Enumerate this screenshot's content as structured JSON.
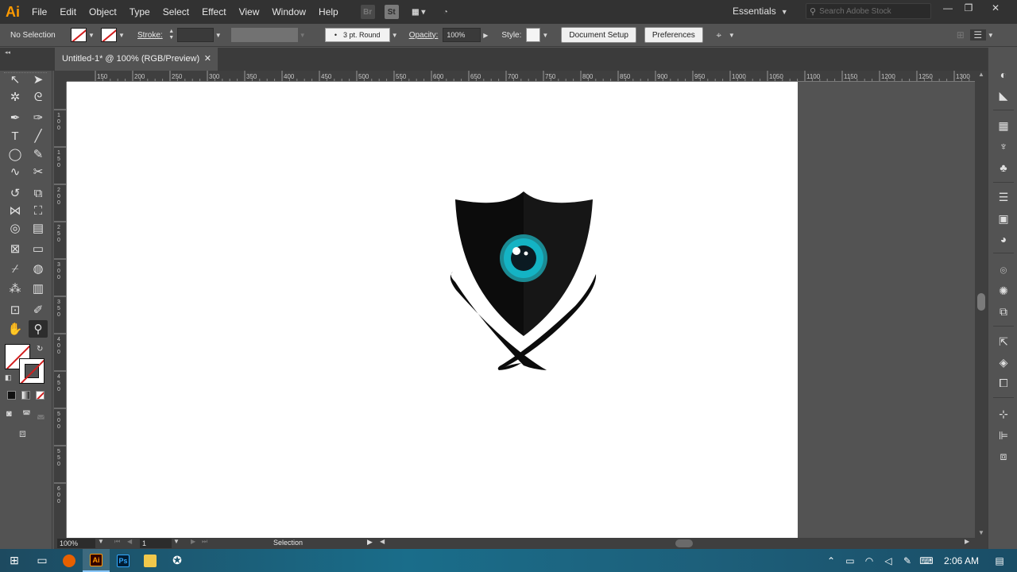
{
  "app": {
    "logo": "Ai"
  },
  "menu": [
    "File",
    "Edit",
    "Object",
    "Type",
    "Select",
    "Effect",
    "View",
    "Window",
    "Help"
  ],
  "menubar_icons": {
    "bridge": "Br",
    "stock": "St"
  },
  "workspace": "Essentials",
  "search": {
    "placeholder": "Search Adobe Stock"
  },
  "window_controls": {
    "minimize": "—",
    "restore": "❐",
    "close": "✕"
  },
  "control_bar": {
    "selection_label": "No Selection",
    "stroke_label": "Stroke:",
    "brush": "3 pt. Round",
    "opacity_label": "Opacity:",
    "opacity_value": "100%",
    "style_label": "Style:",
    "document_setup": "Document Setup",
    "preferences": "Preferences"
  },
  "tab": {
    "title": "Untitled-1* @ 100% (RGB/Preview)",
    "close": "✕"
  },
  "ruler": {
    "top": [
      "150",
      "200",
      "250",
      "300",
      "350",
      "400",
      "450",
      "500",
      "550",
      "600",
      "650",
      "700",
      "750",
      "800",
      "850",
      "900",
      "950",
      "1000",
      "1050",
      "1100",
      "1150",
      "1200",
      "1250",
      "1300"
    ],
    "left": [
      "100",
      "150",
      "200",
      "250",
      "300",
      "350",
      "400",
      "450",
      "500",
      "550",
      "600"
    ]
  },
  "status": {
    "zoom": "100%",
    "artboard": "1",
    "tool": "Selection"
  },
  "artwork": {
    "shield_left": "#0c0c0c",
    "shield_right": "#161616",
    "eye_ring": "#1b8a93",
    "iris": "#14b3c4",
    "pupil": "#0b1a22"
  },
  "taskbar": {
    "time": "2:06 AM",
    "apps": [
      "Ai",
      "Ps"
    ]
  }
}
